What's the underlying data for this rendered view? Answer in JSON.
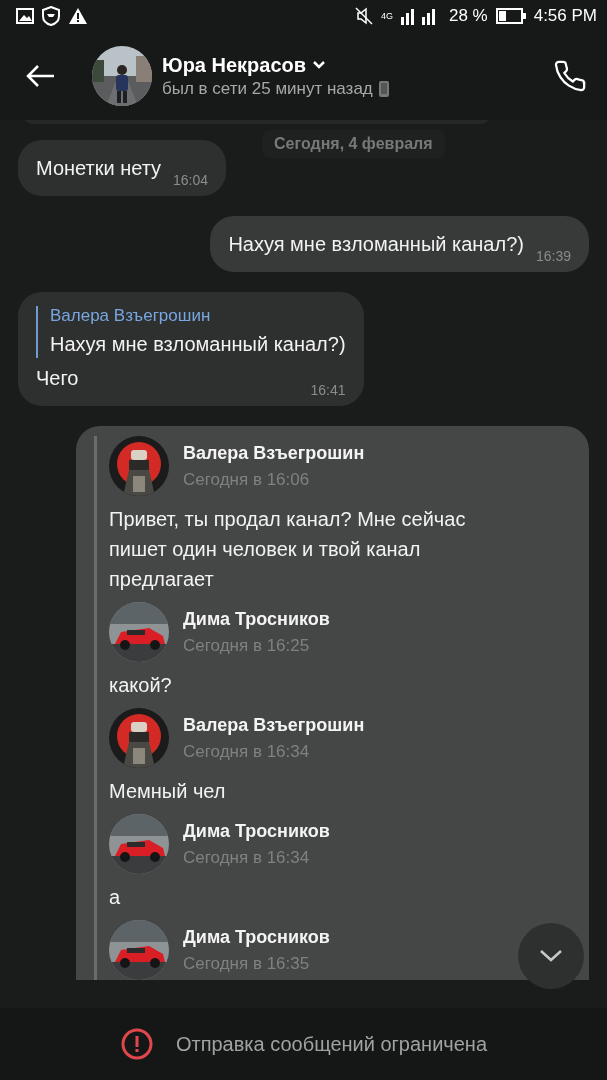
{
  "status_bar": {
    "network": "4G",
    "battery": "28 %",
    "time": "4:56 PM"
  },
  "header": {
    "name": "Юра Некрасов",
    "status": "был в сети 25 минут назад"
  },
  "date_separator": "Сегодня, 4 февраля",
  "messages": [
    {
      "kind": "incoming",
      "text": "Монетки нету",
      "time": "16:04"
    },
    {
      "kind": "outgoing",
      "text": "Нахуя мне взломанный канал?)",
      "time": "16:39"
    },
    {
      "kind": "reply",
      "quote_author": "Валера Взъегрошин",
      "quote_text": "Нахуя мне взломанный канал?)",
      "text": "Чего",
      "time": "16:41"
    },
    {
      "kind": "forward",
      "items": [
        {
          "author": "Валера Взъегрошин",
          "time": "Сегодня в 16:06",
          "kind": "emblem",
          "text": "Привет, ты продал канал? Мне сейчас пишет один человек и твой канал предлагает"
        },
        {
          "author": "Дима Тросников",
          "time": "Сегодня в 16:25",
          "kind": "car",
          "text": "какой?"
        },
        {
          "author": "Валера Взъегрошин",
          "time": "Сегодня в 16:34",
          "kind": "emblem",
          "text": "Мемный чел"
        },
        {
          "author": "Дима Тросников",
          "time": "Сегодня в 16:34",
          "kind": "car",
          "text": "а"
        },
        {
          "author": "Дима Тросников",
          "time": "Сегодня в 16:35",
          "kind": "car"
        }
      ]
    }
  ],
  "banner": {
    "text": "Отправка сообщений ограничена"
  }
}
